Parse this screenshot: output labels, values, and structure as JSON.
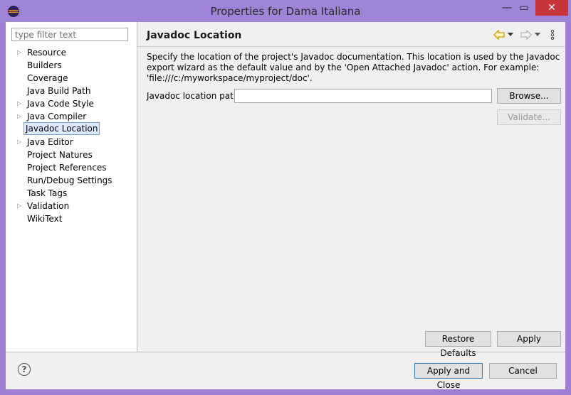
{
  "window": {
    "title": "Properties for Dama Italiana",
    "minimize_glyph": "—",
    "maximize_glyph": "▭",
    "close_glyph": "✕"
  },
  "filter": {
    "placeholder": "type filter text"
  },
  "tree": [
    {
      "label": "Resource",
      "expandable": true
    },
    {
      "label": "Builders",
      "expandable": false
    },
    {
      "label": "Coverage",
      "expandable": false
    },
    {
      "label": "Java Build Path",
      "expandable": false
    },
    {
      "label": "Java Code Style",
      "expandable": true
    },
    {
      "label": "Java Compiler",
      "expandable": true
    },
    {
      "label": "Javadoc Location",
      "expandable": false,
      "selected": true
    },
    {
      "label": "Java Editor",
      "expandable": true
    },
    {
      "label": "Project Natures",
      "expandable": false
    },
    {
      "label": "Project References",
      "expandable": false
    },
    {
      "label": "Run/Debug Settings",
      "expandable": false
    },
    {
      "label": "Task Tags",
      "expandable": false
    },
    {
      "label": "Validation",
      "expandable": true
    },
    {
      "label": "WikiText",
      "expandable": false
    }
  ],
  "page": {
    "title": "Javadoc Location",
    "description": "Specify the location of the project's Javadoc documentation. This location is used by the Javadoc export wizard as the default value and by the 'Open Attached Javadoc' action. For example: 'file:///c:/myworkspace/myproject/doc'.",
    "location_label": "Javadoc location path:",
    "location_value": "",
    "browse_label": "Browse...",
    "validate_label": "Validate...",
    "restore_label": "Restore Defaults",
    "apply_label": "Apply"
  },
  "nav": {
    "back_icon": "back-arrow-icon",
    "forward_icon": "forward-arrow-icon",
    "menu_icon": "view-menu-icon",
    "accent": "#e0a400"
  },
  "footer": {
    "help_glyph": "?",
    "apply_close_label": "Apply and Close",
    "cancel_label": "Cancel"
  }
}
